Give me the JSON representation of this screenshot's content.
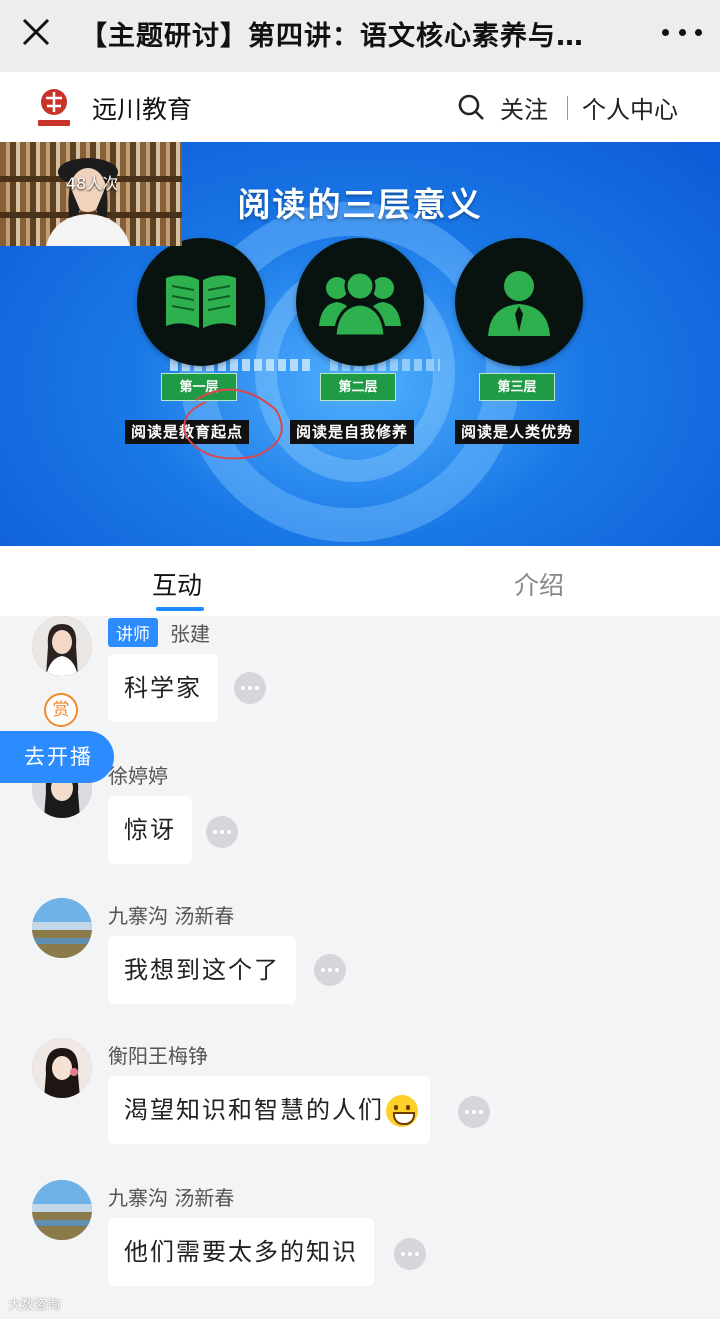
{
  "window": {
    "title": "【主题研讨】第四讲：语文核心素养与…"
  },
  "header": {
    "brand": "远川教育",
    "follow_label": "关注",
    "profile_label": "个人中心"
  },
  "live": {
    "viewers": "48人次",
    "slide_title": "阅读的三层意义",
    "layers": [
      {
        "tag": "第一层",
        "caption": "阅读是教育起点",
        "icon": "open-book-icon"
      },
      {
        "tag": "第二层",
        "caption": "阅读是自我修养",
        "icon": "group-people-icon"
      },
      {
        "tag": "第三层",
        "caption": "阅读是人类优势",
        "icon": "person-icon"
      }
    ]
  },
  "tabs": {
    "interact": "互动",
    "intro": "介绍"
  },
  "chat": {
    "reward_label": "赏",
    "golive_label": "去开播",
    "messages": [
      {
        "badge": "讲师",
        "name": "张建",
        "text": "科学家"
      },
      {
        "name": "徐婷婷",
        "text": "惊讶"
      },
      {
        "name": "九寨沟 汤新春",
        "text": "我想到这个了"
      },
      {
        "name": "衡阳王梅铮",
        "text": "渴望知识和智慧的人们"
      },
      {
        "name": "九寨沟 汤新春",
        "text": "他们需要太多的知识"
      }
    ]
  },
  "watermark": "大数咨询",
  "colors": {
    "accent": "#2b8bff",
    "tag_green": "#1f9a45",
    "reward_orange": "#f08a2a"
  }
}
